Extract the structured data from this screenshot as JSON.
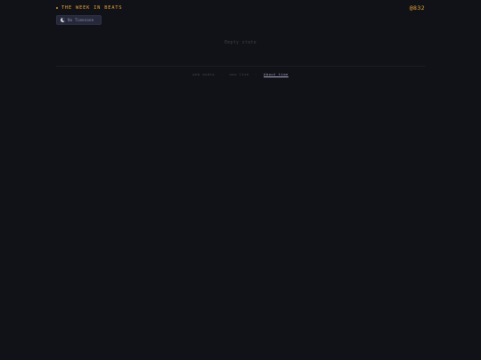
{
  "header": {
    "title": "THE WEEK IN BEATS",
    "handle": "@832"
  },
  "chip": {
    "icon": "moon-icon",
    "label": "No Timezone"
  },
  "main": {
    "empty_state": "Empty state"
  },
  "footer": {
    "item1": "web audio",
    "separator1": "·",
    "item2": "now live",
    "separator2": "·",
    "link": "About time"
  },
  "colors": {
    "background": "#111217",
    "accent": "#f0a93c",
    "chip_bg": "#26283a",
    "link": "#a7a8c8"
  }
}
